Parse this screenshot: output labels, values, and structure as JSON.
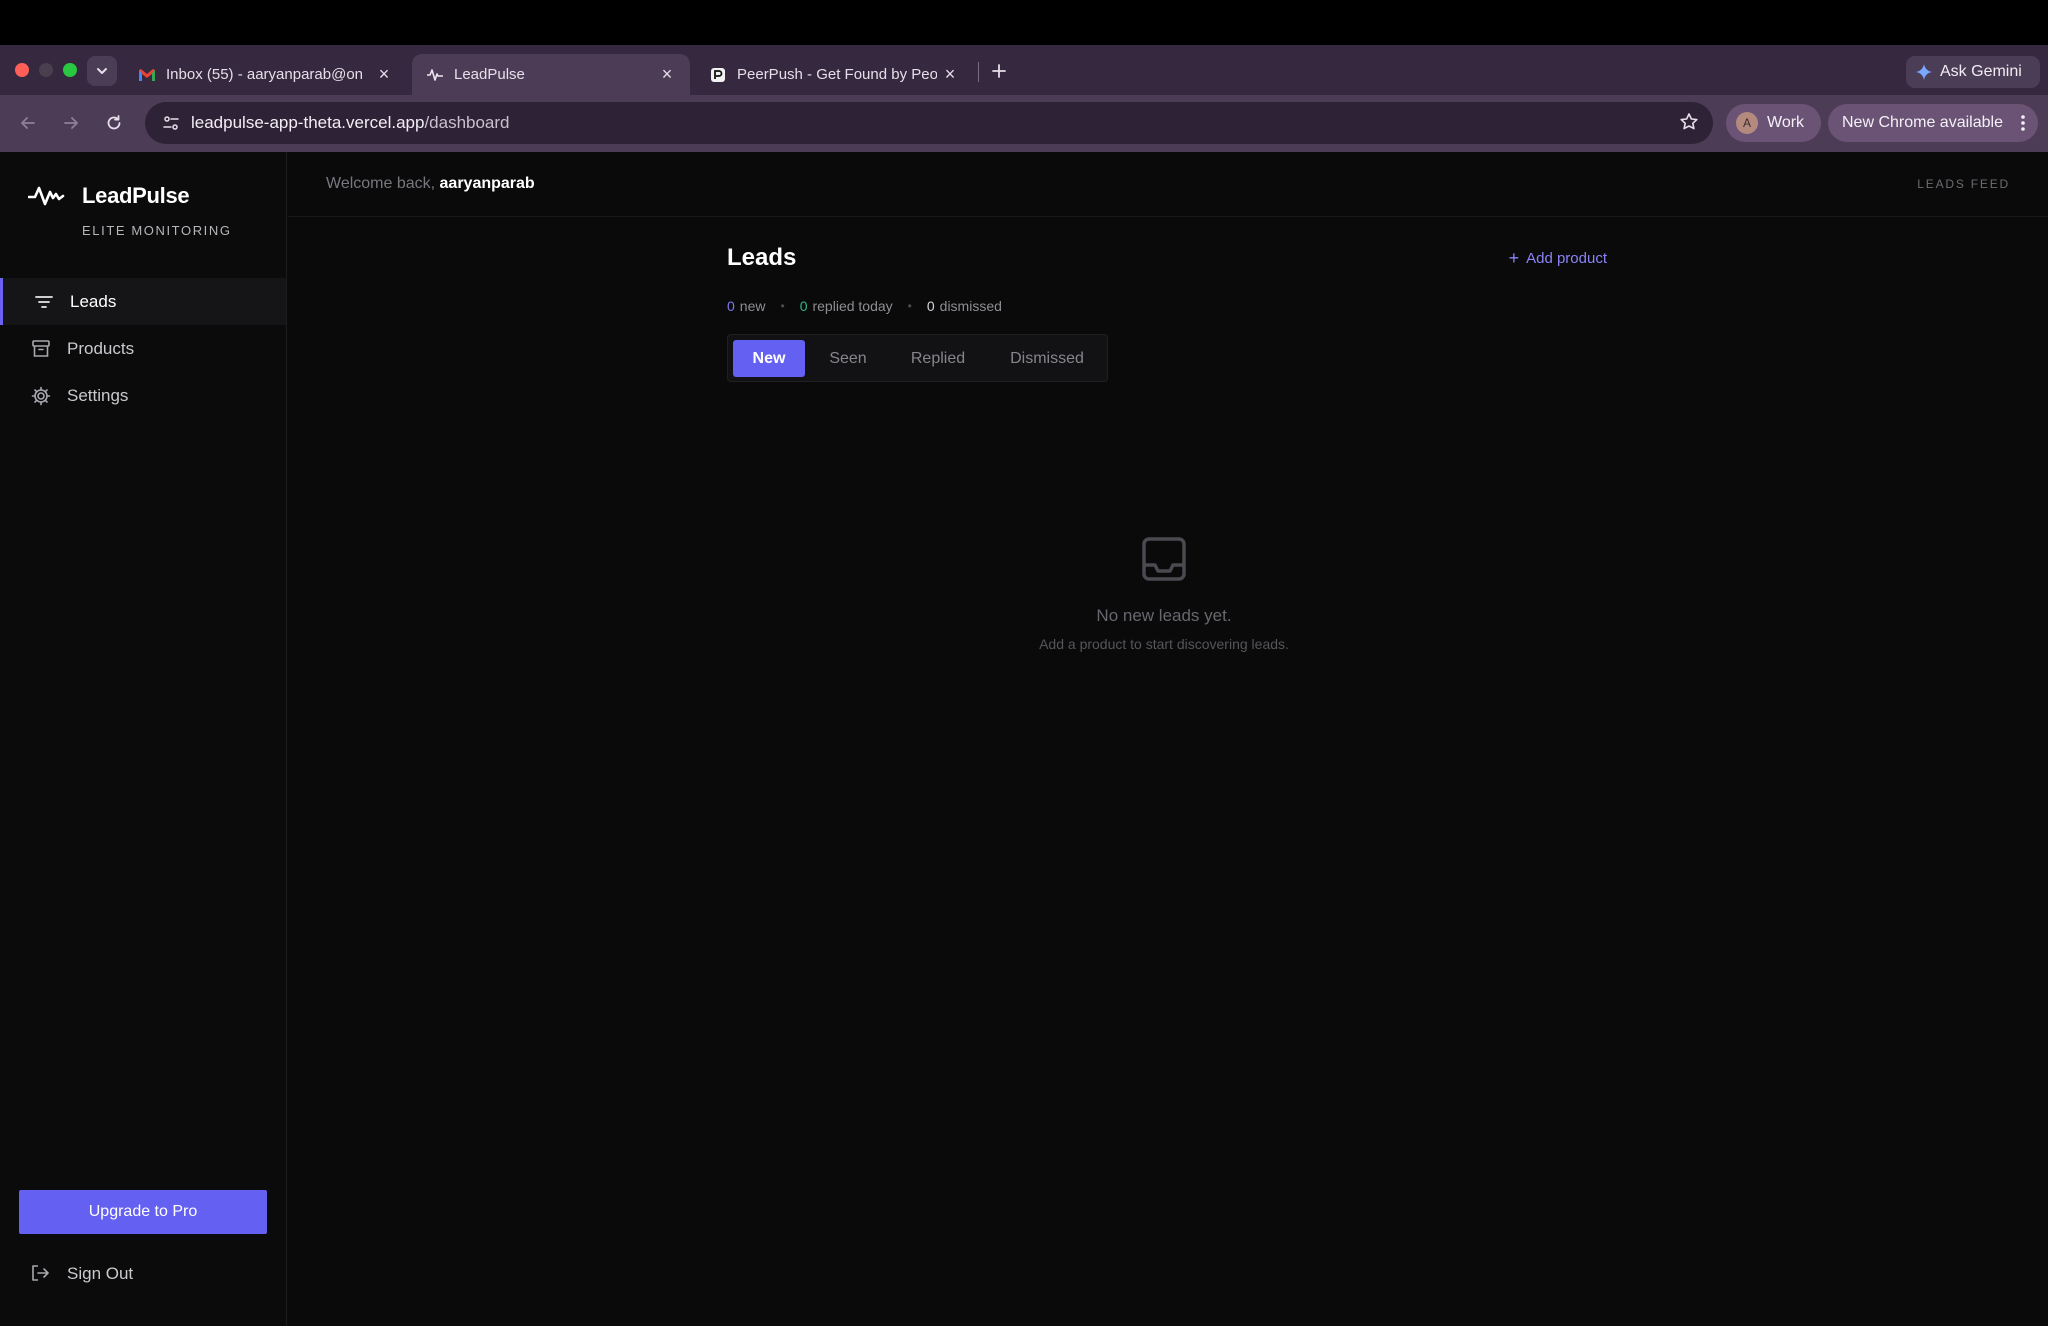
{
  "browser": {
    "tabs": [
      {
        "label": "Inbox (55) - aaryanparab@on",
        "icon": "gmail-icon"
      },
      {
        "label": "LeadPulse",
        "icon": "pulse-icon"
      },
      {
        "label": "PeerPush - Get Found by Peo",
        "icon": "peerpush-icon"
      }
    ],
    "ask_gemini": "Ask Gemini",
    "url_host": "leadpulse-app-theta.vercel.app",
    "url_path": "/dashboard",
    "profile_initial": "A",
    "profile_label": "Work",
    "update_label": "New Chrome available"
  },
  "sidebar": {
    "brand_name": "LeadPulse",
    "brand_sub": "ELITE MONITORING",
    "items": [
      {
        "label": "Leads",
        "icon": "filter-lines-icon",
        "active": true
      },
      {
        "label": "Products",
        "icon": "archive-box-icon",
        "active": false
      },
      {
        "label": "Settings",
        "icon": "gear-icon",
        "active": false
      }
    ],
    "upgrade_label": "Upgrade to Pro",
    "signout_label": "Sign Out"
  },
  "header": {
    "welcome_prefix": "Welcome back,",
    "username": "aaryanparab",
    "feed_label": "LEADS FEED"
  },
  "main": {
    "title": "Leads",
    "add_product_label": "Add product",
    "stats": {
      "new_count": "0",
      "new_label": "new",
      "replied_count": "0",
      "replied_label": "replied today",
      "dismissed_count": "0",
      "dismissed_label": "dismissed"
    },
    "tabs": [
      "New",
      "Seen",
      "Replied",
      "Dismissed"
    ],
    "empty_title": "No new leads yet.",
    "empty_subtitle": "Add a product to start discovering leads."
  },
  "colors": {
    "accent": "#6460f2",
    "replied": "#2fb98a",
    "background": "#0a0a0a"
  }
}
